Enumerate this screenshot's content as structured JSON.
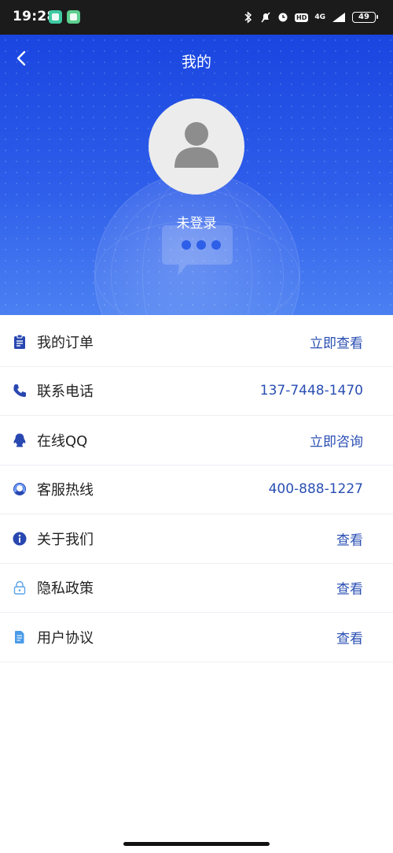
{
  "status_bar": {
    "time": "19:28",
    "hd": "HD",
    "network": "4G",
    "battery": "49"
  },
  "header": {
    "title": "我的",
    "login_status": "未登录"
  },
  "menu": [
    {
      "label": "我的订单",
      "value": "立即查看",
      "icon": "clipboard-icon"
    },
    {
      "label": "联系电话",
      "value": "137-7448-1470",
      "icon": "phone-icon"
    },
    {
      "label": "在线QQ",
      "value": "立即咨询",
      "icon": "qq-icon"
    },
    {
      "label": "客服热线",
      "value": "400-888-1227",
      "icon": "headset-icon"
    },
    {
      "label": "关于我们",
      "value": "查看",
      "icon": "info-icon"
    },
    {
      "label": "隐私政策",
      "value": "查看",
      "icon": "lock-icon"
    },
    {
      "label": "用户协议",
      "value": "查看",
      "icon": "document-icon"
    }
  ],
  "colors": {
    "header_top": "#1a45e0",
    "header_bottom": "#4b80f2",
    "accent": "#2a4fb3",
    "icon": "#2847b0"
  }
}
